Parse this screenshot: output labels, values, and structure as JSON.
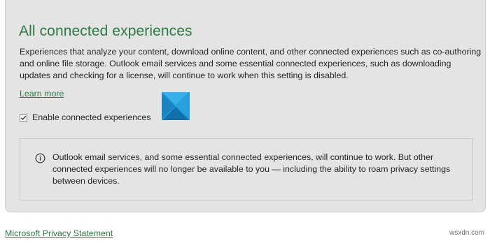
{
  "connected_experiences": {
    "title": "All connected experiences",
    "description": "Experiences that analyze your content, download online content, and other connected experiences such as co-authoring and online file storage. Outlook email services and some essential connected experiences, such as downloading updates and checking for a license, will continue to work when this setting is disabled.",
    "learn_more_label": "Learn more",
    "checkbox": {
      "label": "Enable connected experiences",
      "checked": true
    },
    "info": {
      "icon": "info-icon",
      "text": "Outlook email services, and some essential connected experiences, will continue to work. But other connected experiences will no longer be available to you — including the ability to roam privacy settings between devices."
    }
  },
  "footer": {
    "privacy_link_label": "Microsoft Privacy Statement"
  },
  "watermark": {
    "text": "wsxdn.com"
  },
  "colors": {
    "accent_green": "#2e7a45",
    "panel_background": "#e4e4e4",
    "logo_blue": "#1e9ad6"
  }
}
